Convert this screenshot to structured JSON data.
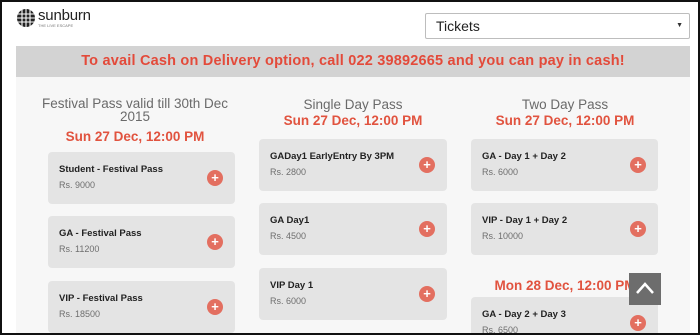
{
  "header": {
    "logo_name": "sunburn",
    "logo_tagline": "THE LIVE ESCAPE",
    "select_value": "Tickets"
  },
  "banner": {
    "text": "To avail Cash on Delivery option, call 022 39892665 and you can pay in cash!"
  },
  "columns": [
    {
      "title": "Festival Pass valid till 30th Dec 2015",
      "date": "Sun 27 Dec, 12:00 PM",
      "tickets": [
        {
          "name": "Student - Festival Pass",
          "price": "Rs. 9000"
        },
        {
          "name": "GA - Festival Pass",
          "price": "Rs. 11200"
        },
        {
          "name": "VIP - Festival Pass",
          "price": "Rs. 18500"
        }
      ]
    },
    {
      "title": "Single Day Pass",
      "date": "Sun 27 Dec, 12:00 PM",
      "tickets": [
        {
          "name": "GADay1 EarlyEntry By 3PM",
          "price": "Rs. 2800"
        },
        {
          "name": "GA Day1",
          "price": "Rs. 4500"
        },
        {
          "name": "VIP Day 1",
          "price": "Rs. 6000"
        }
      ]
    },
    {
      "title": "Two Day Pass",
      "date": "Sun 27 Dec, 12:00 PM",
      "date2": "Mon 28 Dec, 12:00 PM",
      "tickets": [
        {
          "name": "GA - Day 1 + Day 2",
          "price": "Rs. 6000"
        },
        {
          "name": "VIP - Day 1 + Day 2",
          "price": "Rs. 10000"
        },
        {
          "name": "GA - Day 2 + Day 3",
          "price": "Rs. 6500"
        }
      ]
    }
  ],
  "add_label": "+",
  "colors": {
    "accent": "#e1533f",
    "add_button": "#e36f60",
    "card": "#e4e4e4",
    "banner_bg": "#d3d3d3"
  },
  "icons": {
    "logo": "globe-grid-icon",
    "add": "plus-icon",
    "scroll_top": "chevron-up-icon",
    "select": "caret-down-icon"
  }
}
